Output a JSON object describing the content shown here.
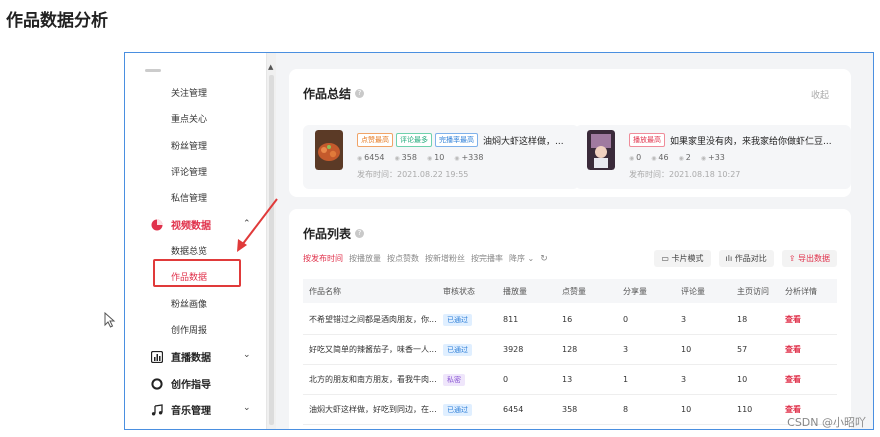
{
  "doc": {
    "heading": "作品数据分析",
    "watermark": "CSDN @小昭吖"
  },
  "sidebar": {
    "items_top": [
      "关注管理",
      "重点关心",
      "粉丝管理",
      "评论管理",
      "私信管理"
    ],
    "video_group": "视频数据",
    "video_items": [
      "数据总览",
      "作品数据",
      "粉丝画像",
      "创作周报"
    ],
    "groups_bottom": [
      "直播数据",
      "创作指导",
      "音乐管理"
    ]
  },
  "summary": {
    "title": "作品总结",
    "collapse": "收起",
    "works": [
      {
        "tags": [
          {
            "text": "点赞最高",
            "color": "orange"
          },
          {
            "text": "评论最多",
            "color": "green"
          },
          {
            "text": "完播率最高",
            "color": "blue"
          }
        ],
        "title": "油焖大虾这样做，...",
        "stats": [
          "6454",
          "358",
          "10",
          "+338"
        ],
        "date": "发布时间：2021.08.22 19:55"
      },
      {
        "tags": [
          {
            "text": "播放最高",
            "color": "red"
          }
        ],
        "title": "如果家里没有肉，来我家给你做虾仁豆...",
        "stats": [
          "0",
          "46",
          "2",
          "+33"
        ],
        "date": "发布时间：2021.08.18 10:27"
      }
    ]
  },
  "list": {
    "title": "作品列表",
    "sorts": [
      "按发布时间",
      "按播放量",
      "按点赞数",
      "按新增粉丝",
      "按完播率",
      "降序"
    ],
    "actions": [
      "卡片模式",
      "作品对比",
      "导出数据"
    ],
    "columns": [
      "作品名称",
      "审核状态",
      "播放量",
      "点赞量",
      "分享量",
      "评论量",
      "主页访问",
      "分析详情"
    ],
    "rows": [
      {
        "name": "不希望错过之间都是酒肉朋友，你...",
        "status": "已通过",
        "status_type": "pass",
        "plays": "811",
        "likes": "16",
        "shares": "0",
        "comments": "3",
        "visits": "18",
        "detail": "查看"
      },
      {
        "name": "好吃又简单的辣酱茄子，味香一人...",
        "status": "已通过",
        "status_type": "pass",
        "plays": "3928",
        "likes": "128",
        "shares": "3",
        "comments": "10",
        "visits": "57",
        "detail": "查看"
      },
      {
        "name": "北方的朋友和南方朋友，看我牛肉...",
        "status": "私密",
        "status_type": "private",
        "plays": "0",
        "likes": "13",
        "shares": "1",
        "comments": "3",
        "visits": "10",
        "detail": "查看"
      },
      {
        "name": "油焖大虾这样做，好吃到同边，在...",
        "status": "已通过",
        "status_type": "pass",
        "plays": "6454",
        "likes": "358",
        "shares": "8",
        "comments": "10",
        "visits": "110",
        "detail": "查看"
      }
    ]
  },
  "colors": {
    "accent": "#e0314b",
    "frame_border": "#4a8fe0",
    "highlight": "#e03a3a"
  }
}
